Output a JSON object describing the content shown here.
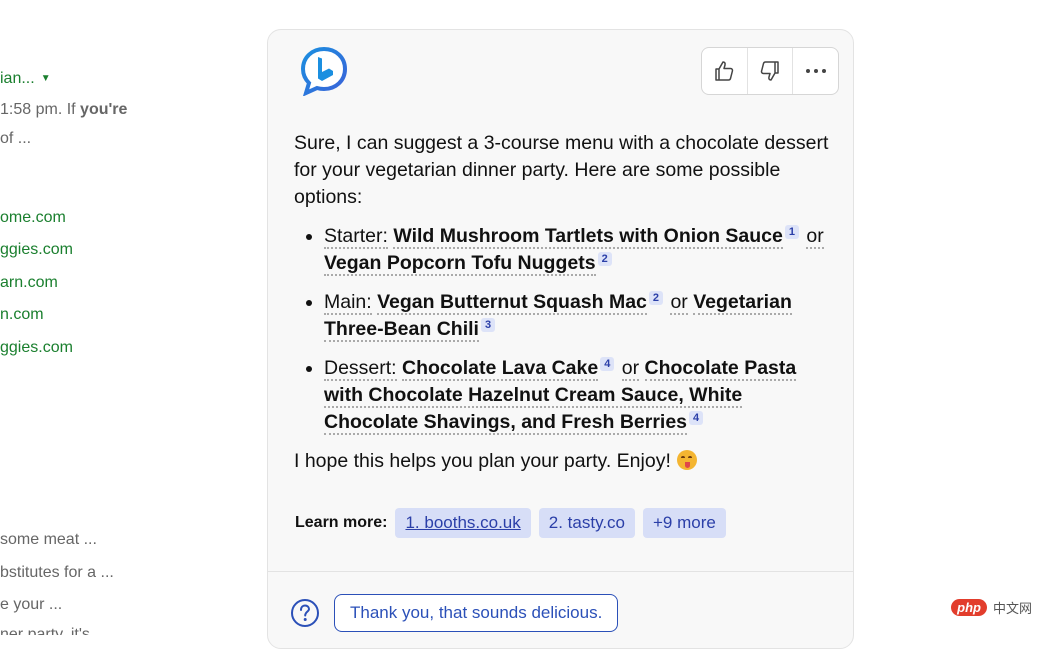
{
  "left_results": {
    "title_fragment": "ian...",
    "snippet_line1_prefix": "1:58 pm. If ",
    "snippet_line1_bold": "you're",
    "snippet_line2": "of ...",
    "urls": [
      "ome.com",
      "ggies.com",
      "arn.com",
      "n.com",
      "ggies.com"
    ],
    "related": [
      "some meat ...",
      "bstitutes for a ...",
      "e your ...",
      "ner party, it's"
    ]
  },
  "chat": {
    "intro": "Sure, I can suggest a 3-course menu with a chocolate dessert for your vegetarian dinner party. Here are some possible options:",
    "items": [
      {
        "label": "Starter:",
        "opt1": "Wild Mushroom Tartlets with Onion Sauce",
        "cite1": "1",
        "or": "or",
        "opt2": "Vegan Popcorn Tofu Nuggets",
        "cite2": "2"
      },
      {
        "label": "Main:",
        "opt1": "Vegan Butternut Squash Mac",
        "cite1": "2",
        "or": "or",
        "opt2": "Vegetarian Three-Bean Chili",
        "cite2": "3"
      },
      {
        "label": "Dessert:",
        "opt1": "Chocolate Lava Cake",
        "cite1": "4",
        "or": "or",
        "opt2": "Chocolate Pasta with Chocolate Hazelnut Cream Sauce, White Chocolate Shavings, and Fresh Berries",
        "cite2": "4"
      }
    ],
    "closing": "I hope this helps you plan your party. Enjoy!",
    "learn_more_label": "Learn more:",
    "sources": [
      "1. booths.co.uk",
      "2. tasty.co",
      "+9 more"
    ],
    "suggestion": "Thank you, that sounds delicious."
  },
  "icons": {
    "logo": "bing-chat-logo",
    "like": "thumbs-up-icon",
    "dislike": "thumbs-down-icon",
    "more": "more-icon",
    "help": "question-icon"
  },
  "watermark": {
    "badge": "php",
    "text": "中文网"
  },
  "colors": {
    "accent": "#2b50b8",
    "chip_bg": "#d7def7",
    "url_green": "#1a7f2e"
  }
}
